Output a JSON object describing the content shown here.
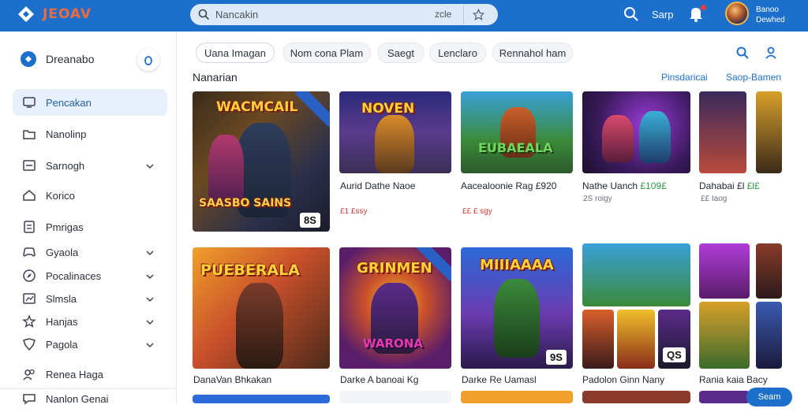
{
  "header": {
    "logo_text": "JEOAV",
    "search_placeholder": "Nancakin",
    "search_hint": "zcle",
    "sign_label": "Sarp",
    "user_line1": "Banoo",
    "user_line2": "Dewhed"
  },
  "sidebar": {
    "title": "Dreanabo",
    "items": [
      {
        "label": "Pencakan",
        "icon": "monitor-icon",
        "active": true,
        "chevron": false
      },
      {
        "label": "Nanolinp",
        "icon": "folder-icon",
        "active": false,
        "chevron": false
      },
      {
        "label": "Sarnogh",
        "icon": "image-icon",
        "active": false,
        "chevron": true
      },
      {
        "label": "Korico",
        "icon": "home-icon",
        "active": false,
        "chevron": false
      },
      {
        "label": "Pmrigas",
        "icon": "document-icon",
        "active": false,
        "chevron": false
      },
      {
        "label": "Gyaola",
        "icon": "gamepad-icon",
        "active": false,
        "chevron": true
      },
      {
        "label": "Pocalinaces",
        "icon": "compass-icon",
        "active": false,
        "chevron": true
      },
      {
        "label": "Slmsla",
        "icon": "chart-icon",
        "active": false,
        "chevron": true
      },
      {
        "label": "Hanjas",
        "icon": "star-icon",
        "active": false,
        "chevron": true
      },
      {
        "label": "Pagola",
        "icon": "shield-icon",
        "active": false,
        "chevron": true
      },
      {
        "label": "Renea Haga",
        "icon": "user-group-icon",
        "active": false,
        "chevron": false
      },
      {
        "label": "Nanlon Genai",
        "icon": "chat-icon",
        "active": false,
        "chevron": false
      }
    ]
  },
  "chips": [
    "Uana Imagan",
    "Nom cona Plam",
    "Saegt",
    "Lenclaro",
    "Rennahol ham"
  ],
  "section": {
    "title": "Nanarian",
    "link1": "Pinsdaricai",
    "link2": "Saop-Bamen"
  },
  "cards_row1": [
    {
      "game_title": "WACMCAIL",
      "subtitle_art": "SAASBO SAINS",
      "score": "8S",
      "label": "",
      "price_old": "",
      "price_new": "",
      "sub": ""
    },
    {
      "game_title": "NOVEN",
      "label": "Aurid Dathe Naoe",
      "price_old": "£1 £ssy",
      "price_new": "",
      "sub": ""
    },
    {
      "game_title": "EUBAEALA",
      "label": "Aacealoonie Rag £920",
      "price_old": "££ £ sgy",
      "price_new": "",
      "sub": ""
    },
    {
      "game_title": "",
      "label": "Nathe Uanch",
      "price_old": "",
      "price_new": "£109£",
      "sub": "2S roigy"
    },
    {
      "game_title": "",
      "label": "Dahabai £l",
      "price_old": "",
      "price_new": "£l£",
      "sub": "££ Iaog"
    }
  ],
  "cards_row2": [
    {
      "game_title": "PUEBERALA",
      "label": "DanaVan Bhkakan"
    },
    {
      "game_title": "GRINMEN",
      "subtitle_art": "WARONA",
      "label": "Darke A banoai Kg"
    },
    {
      "game_title": "MIIIAAAA",
      "score": "9S",
      "label": "Darke Re Uamasl"
    },
    {
      "game_title": "",
      "score": "QS",
      "label": "Padolon Ginn Nany"
    },
    {
      "game_title": "",
      "label": "Rania kaia Bacy"
    }
  ],
  "bottom_button": "Seam"
}
